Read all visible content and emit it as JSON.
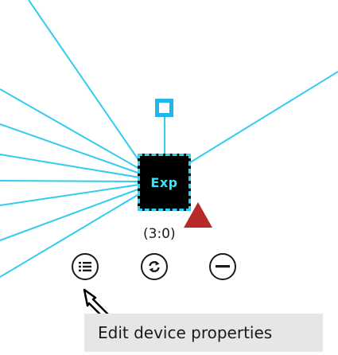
{
  "device": {
    "label": "Exp",
    "coords": "(3:0)",
    "icon": "device-node-icon",
    "link_color": "#33ccf0",
    "alert_color": "#b82a2a"
  },
  "actions": [
    {
      "name": "properties",
      "icon": "list-icon"
    },
    {
      "name": "refresh",
      "icon": "sync-icon"
    },
    {
      "name": "remove",
      "icon": "minus-icon"
    }
  ],
  "tooltip": {
    "text": "Edit device properties"
  }
}
